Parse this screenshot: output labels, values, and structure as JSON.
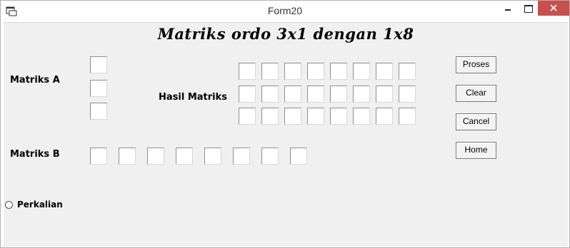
{
  "window": {
    "title": "Form20"
  },
  "heading": "Matriks ordo 3x1 dengan 1x8",
  "labels": {
    "matriks_a": "Matriks A",
    "hasil_matriks": "Hasil Matriks",
    "matriks_b": "Matriks B",
    "perkalian": "Perkalian"
  },
  "buttons": {
    "proses": "Proses",
    "clear": "Clear",
    "cancel": "Cancel",
    "home": "Home"
  },
  "matriks_a_values": [
    "",
    "",
    ""
  ],
  "matriks_b_values": [
    "",
    "",
    "",
    "",
    "",
    "",
    "",
    ""
  ],
  "hasil_values": [
    [
      "",
      "",
      "",
      "",
      "",
      "",
      "",
      ""
    ],
    [
      "",
      "",
      "",
      "",
      "",
      "",
      "",
      ""
    ],
    [
      "",
      "",
      "",
      "",
      "",
      "",
      "",
      ""
    ]
  ],
  "radio_perkalian_selected": false,
  "colors": {
    "close_button": "#c7504d",
    "form_background": "#f0f0f0"
  }
}
